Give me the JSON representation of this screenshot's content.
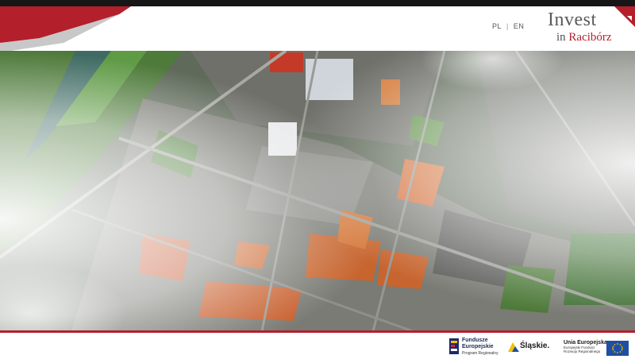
{
  "header": {
    "languages": [
      {
        "code": "PL",
        "active": true
      },
      {
        "code": "EN",
        "active": false
      }
    ],
    "separator": "|",
    "logo": {
      "line1": "Invest",
      "line2_prefix": "in",
      "line2_city": "Racibórz"
    }
  },
  "main": {
    "image_description": "aerial-city-map",
    "colors": {
      "accent_red": "#b3202c",
      "topbar": "#161616"
    }
  },
  "footer": {
    "funds_logo": {
      "line1": "Fundusze",
      "line2": "Europejskie",
      "line3": "Program Regionalny"
    },
    "region_logo": "Śląskie.",
    "eu_logo": {
      "line1": "Unia Europejska",
      "line2": "Europejski Fundusz",
      "line3": "Rozwoju Regionalnego"
    }
  }
}
